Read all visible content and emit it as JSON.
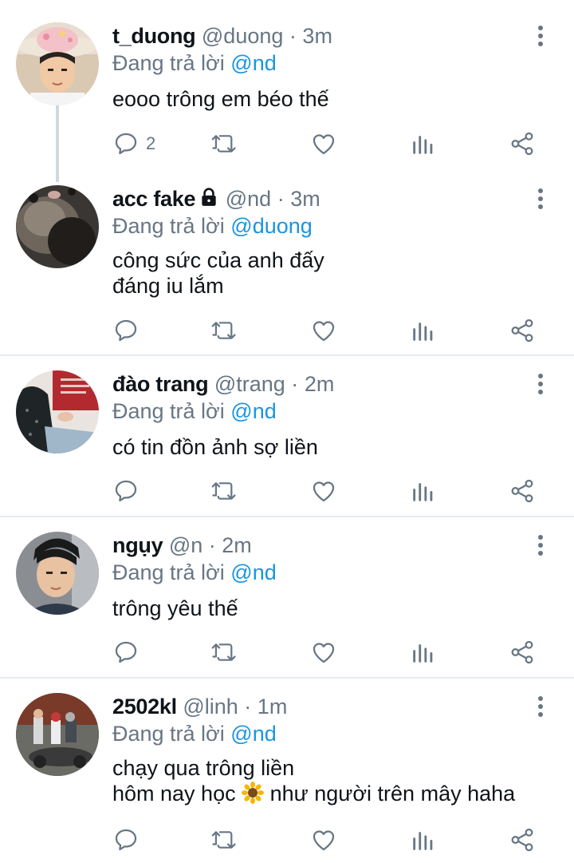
{
  "tweets": [
    {
      "name": "t_duong",
      "handle": "@duong",
      "dot": "·",
      "time": "3m",
      "replying_prefix": "Đang trả lời",
      "replying_to": "@nd",
      "lines": [
        "eooo trông em béo thế"
      ],
      "reply_count": "2"
    },
    {
      "name": "acc fake",
      "handle": "@nd",
      "dot": "·",
      "time": "3m",
      "locked": true,
      "replying_prefix": "Đang trả lời",
      "replying_to": "@duong",
      "lines": [
        "công sức của anh đấy",
        "đáng iu lắm"
      ],
      "reply_count": ""
    },
    {
      "name": "đào trang",
      "handle": "@trang",
      "dot": "·",
      "time": "2m",
      "replying_prefix": "Đang trả lời",
      "replying_to": "@nd",
      "lines": [
        "có tin đồn ảnh sợ liền"
      ],
      "reply_count": ""
    },
    {
      "name": "ngụy",
      "handle": "@n",
      "dot": "·",
      "time": "2m",
      "replying_prefix": "Đang trả lời",
      "replying_to": "@nd",
      "lines": [
        "trông yêu thế"
      ],
      "reply_count": ""
    },
    {
      "name": "2502kl",
      "handle": "@linh",
      "dot": "·",
      "time": "1m",
      "replying_prefix": "Đang trả lời",
      "replying_to": "@nd",
      "lines": [
        "chạy qua trông liền"
      ],
      "line2_before": "hôm nay học",
      "line2_emoji": "sunflower",
      "line2_after": "như người trên mây haha",
      "reply_count": ""
    }
  ],
  "icons": {
    "reply": "reply-icon",
    "retweet": "retweet-icon",
    "like": "heart-icon",
    "analytics": "analytics-icon",
    "share": "share-icon",
    "more": "more-vertical-icon",
    "lock": "lock-icon"
  },
  "colors": {
    "text": "#0f1419",
    "secondary": "#687684",
    "link": "#1b95e0",
    "divider": "#e6ecf0"
  }
}
